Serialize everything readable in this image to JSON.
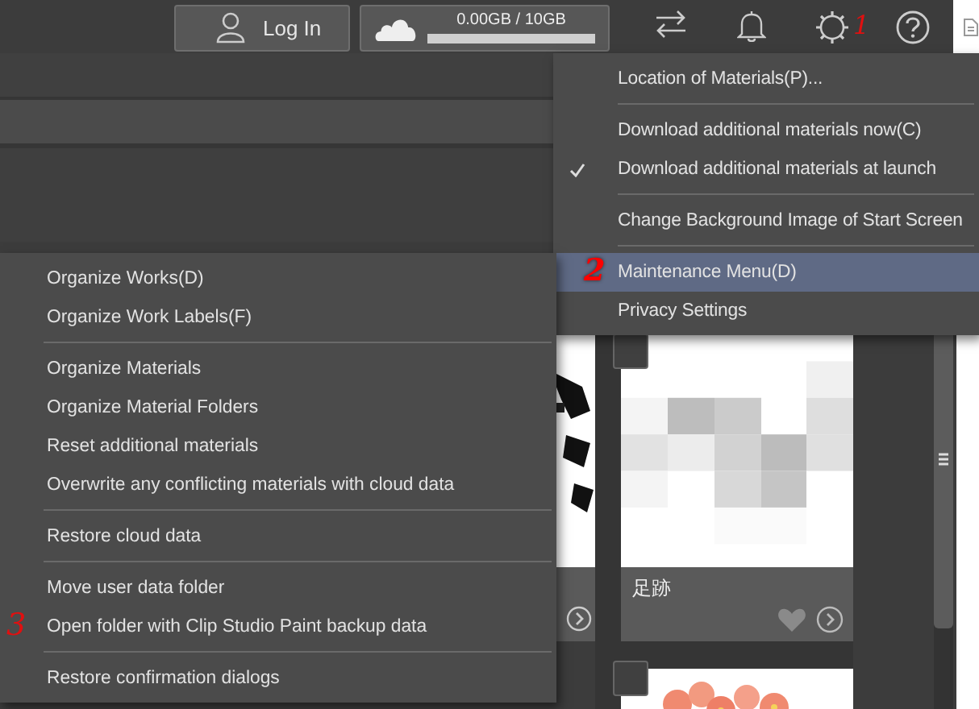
{
  "top_bar": {
    "login_button": "Log In",
    "storage": {
      "label": "0.00GB / 10GB"
    },
    "icons": [
      {
        "kind": "sync"
      },
      {
        "kind": "bell"
      },
      {
        "kind": "settings",
        "annotation": "1"
      },
      {
        "kind": "help"
      }
    ]
  },
  "settings_menu": [
    {
      "kind": "item",
      "label": "Location of Materials(P)...",
      "checked": false,
      "selected": false
    },
    {
      "kind": "separator"
    },
    {
      "kind": "item",
      "label": "Download additional materials now(C)",
      "checked": false,
      "selected": false
    },
    {
      "kind": "item",
      "label": "Download additional materials at launch",
      "checked": true,
      "selected": false
    },
    {
      "kind": "separator"
    },
    {
      "kind": "item",
      "label": "Change Background Image of Start Screen",
      "checked": false,
      "selected": false
    },
    {
      "kind": "separator"
    },
    {
      "kind": "item",
      "label": "Maintenance Menu(D)",
      "checked": false,
      "selected": true,
      "annotation": "2"
    },
    {
      "kind": "item",
      "label": "Privacy Settings",
      "checked": false,
      "selected": false
    }
  ],
  "maintenance_menu": [
    {
      "kind": "item",
      "label": "Organize Works(D)"
    },
    {
      "kind": "item",
      "label": "Organize Work Labels(F)"
    },
    {
      "kind": "separator"
    },
    {
      "kind": "item",
      "label": "Organize Materials"
    },
    {
      "kind": "item",
      "label": "Organize Material Folders"
    },
    {
      "kind": "item",
      "label": "Reset additional materials"
    },
    {
      "kind": "item",
      "label": "Overwrite any conflicting materials with cloud data"
    },
    {
      "kind": "separator"
    },
    {
      "kind": "item",
      "label": "Restore cloud data"
    },
    {
      "kind": "separator"
    },
    {
      "kind": "item",
      "label": "Move user data folder"
    },
    {
      "kind": "item",
      "label": "Open folder with Clip Studio Paint backup data",
      "annotation": "3"
    },
    {
      "kind": "separator"
    },
    {
      "kind": "item",
      "label": "Restore confirmation dialogs"
    }
  ],
  "cards": [
    {
      "title": "足跡",
      "checked": false,
      "favorite": false
    },
    {
      "checked": false
    }
  ]
}
